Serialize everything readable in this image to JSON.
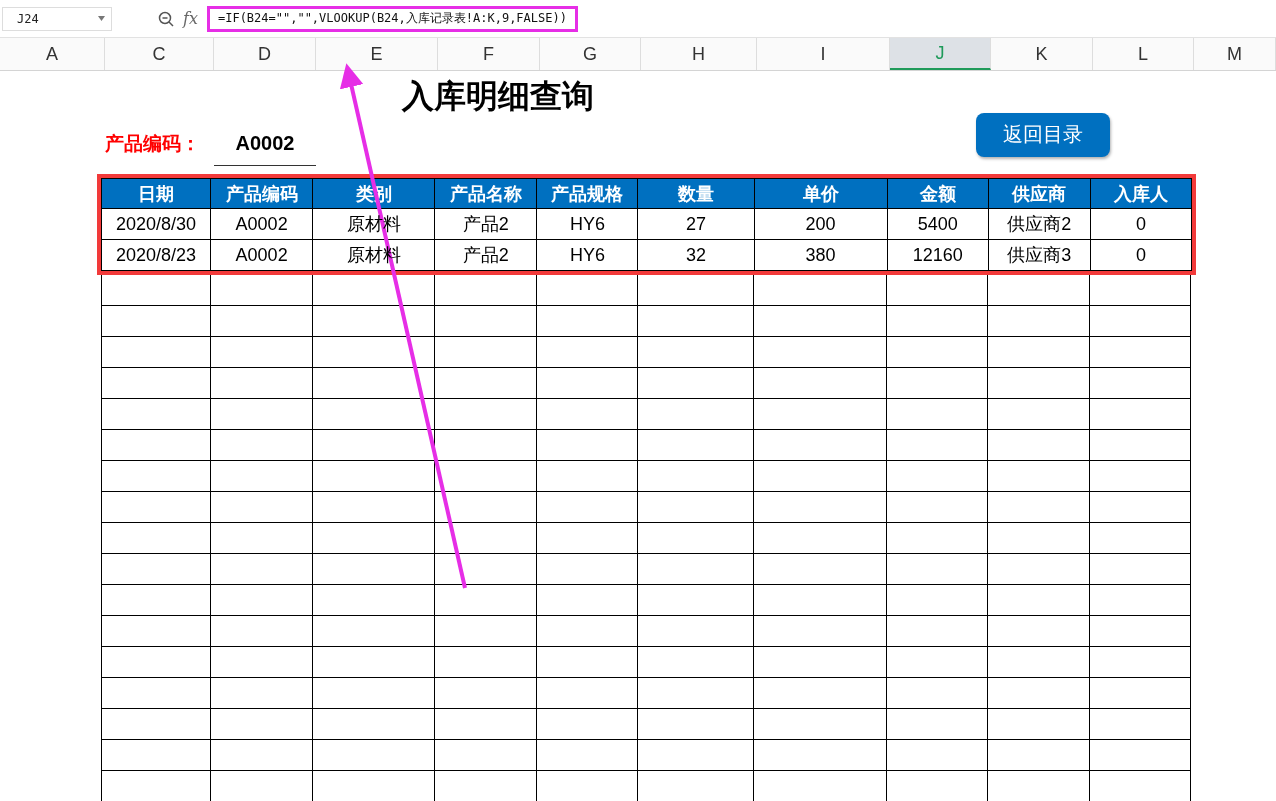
{
  "name_box": {
    "value": "J24"
  },
  "formula_bar": {
    "fx_label": "fx",
    "formula": "=IF(B24=\"\",\"\",VLOOKUP(B24,入库记录表!A:K,9,FALSE))"
  },
  "columns": [
    {
      "label": "A",
      "selected": false
    },
    {
      "label": "C",
      "selected": false
    },
    {
      "label": "D",
      "selected": false
    },
    {
      "label": "E",
      "selected": false
    },
    {
      "label": "F",
      "selected": false
    },
    {
      "label": "G",
      "selected": false
    },
    {
      "label": "H",
      "selected": false
    },
    {
      "label": "I",
      "selected": false
    },
    {
      "label": "J",
      "selected": true
    },
    {
      "label": "K",
      "selected": false
    },
    {
      "label": "L",
      "selected": false
    },
    {
      "label": "M",
      "selected": false
    }
  ],
  "title": "入库明细查询",
  "product_code": {
    "label": "产品编码：",
    "value": "A0002"
  },
  "back_button": "返回目录",
  "table": {
    "columns": [
      "日期",
      "产品编码",
      "类别",
      "产品名称",
      "产品规格",
      "数量",
      "单价",
      "金额",
      "供应商",
      "入库人"
    ],
    "rows": [
      [
        "2020/8/30",
        "A0002",
        "原材料",
        "产品2",
        "HY6",
        "27",
        "200",
        "5400",
        "供应商2",
        "0"
      ],
      [
        "2020/8/23",
        "A0002",
        "原材料",
        "产品2",
        "HY6",
        "32",
        "380",
        "12160",
        "供应商3",
        "0"
      ]
    ]
  }
}
